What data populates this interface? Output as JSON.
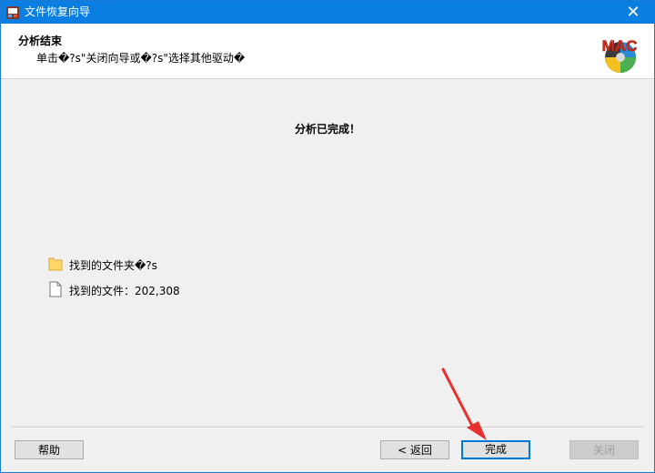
{
  "window": {
    "title": "文件恢复向导",
    "close_symbol": "✕",
    "app_icon": "wizard-app-icon"
  },
  "header": {
    "title": "分析结束",
    "subtitle": "单击�?s\"关闭向导或�?s\"选择其他驱动�",
    "logo_text": "MAC",
    "logo_icon": "mac-drive-logo"
  },
  "main": {
    "status_message": "分析已完成！",
    "results": [
      {
        "icon": "folder-icon",
        "text": "找到的文件夹�?s"
      },
      {
        "icon": "file-icon",
        "text": "找到的文件：202,308"
      }
    ]
  },
  "footer": {
    "help_label": "帮助",
    "back_label": "< 返回",
    "finish_label": "完成",
    "close_label": "关闭",
    "close_disabled": true
  },
  "colors": {
    "titlebar": "#0b7fe1",
    "window_bg": "#f0f0f0",
    "header_bg": "#ffffff",
    "primary_button_border": "#0078d7",
    "annotation_arrow": "#e8312f"
  },
  "annotation": {
    "type": "red-arrow",
    "target": "finish-button"
  }
}
